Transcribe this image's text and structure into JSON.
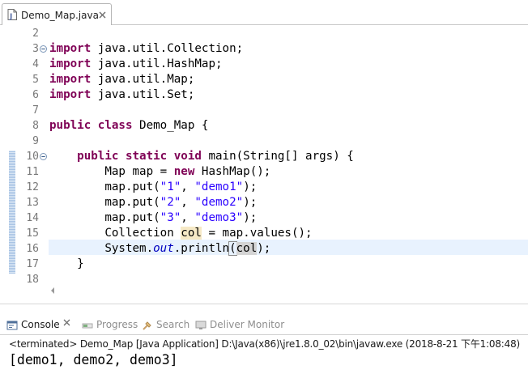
{
  "editor": {
    "tab_title": "Demo_Map.java",
    "line_numbers": [
      "2",
      "3",
      "4",
      "5",
      "6",
      "7",
      "8",
      "9",
      "10",
      "11",
      "12",
      "13",
      "14",
      "15",
      "16",
      "17",
      "18"
    ],
    "code": {
      "line3_kw": "import",
      "line3_rest": " java.util.Collection;",
      "line4_kw": "import",
      "line4_rest": " java.util.HashMap;",
      "line5_kw": "import",
      "line5_rest": " java.util.Map;",
      "line6_kw": "import",
      "line6_rest": " java.util.Set;",
      "line8_kw1": "public",
      "line8_kw2": "class",
      "line8_rest": " Demo_Map {",
      "line10_indent": "    ",
      "line10_kw1": "public",
      "line10_kw2": "static",
      "line10_kw3": "void",
      "line10_rest": " main(String[] args) {",
      "line11_pre": "        Map map = ",
      "line11_kw": "new",
      "line11_rest": " HashMap();",
      "line12_pre": "        map.put(",
      "line12_s1": "\"1\"",
      "line12_mid": ", ",
      "line12_s2": "\"demo1\"",
      "line12_end": ");",
      "line13_pre": "        map.put(",
      "line13_s1": "\"2\"",
      "line13_mid": ", ",
      "line13_s2": "\"demo2\"",
      "line13_end": ");",
      "line14_pre": "        map.put(",
      "line14_s1": "\"3\"",
      "line14_mid": ", ",
      "line14_s2": "\"demo3\"",
      "line14_end": ");",
      "line15_pre": "        Collection ",
      "line15_var": "col",
      "line15_rest": " = map.values();",
      "line16_pre": "        System.",
      "line16_field": "out",
      "line16_mid": ".println",
      "line16_paren": "(",
      "line16_var": "col",
      "line16_end": ");",
      "line17": "    }"
    }
  },
  "console": {
    "tabs": [
      {
        "label": "Console",
        "icon": "console-icon"
      },
      {
        "label": "Progress",
        "icon": "progress-icon"
      },
      {
        "label": "Search",
        "icon": "search-icon"
      },
      {
        "label": "Deliver Monitor",
        "icon": "deliver-monitor-icon"
      }
    ],
    "status": "<terminated> Demo_Map [Java Application] D:\\Java(x86)\\jre1.8.0_02\\bin\\javaw.exe (2018-8-21 下午1:08:48)",
    "output": "[demo1, demo2, demo3]"
  },
  "colors": {
    "keyword": "#7f0055",
    "string": "#2a00ff",
    "static_field": "#0000c0",
    "current_line": "#e8f2fe",
    "occurrence": "#f6e9c6"
  }
}
